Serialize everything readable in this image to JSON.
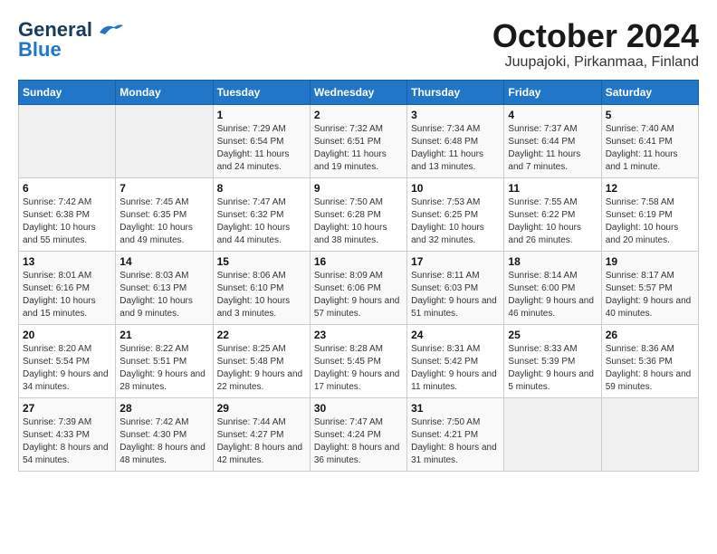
{
  "logo": {
    "line1": "General",
    "line2": "Blue"
  },
  "title": "October 2024",
  "subtitle": "Juupajoki, Pirkanmaa, Finland",
  "headers": [
    "Sunday",
    "Monday",
    "Tuesday",
    "Wednesday",
    "Thursday",
    "Friday",
    "Saturday"
  ],
  "weeks": [
    [
      {
        "day": "",
        "detail": ""
      },
      {
        "day": "",
        "detail": ""
      },
      {
        "day": "1",
        "detail": "Sunrise: 7:29 AM\nSunset: 6:54 PM\nDaylight: 11 hours and 24 minutes."
      },
      {
        "day": "2",
        "detail": "Sunrise: 7:32 AM\nSunset: 6:51 PM\nDaylight: 11 hours and 19 minutes."
      },
      {
        "day": "3",
        "detail": "Sunrise: 7:34 AM\nSunset: 6:48 PM\nDaylight: 11 hours and 13 minutes."
      },
      {
        "day": "4",
        "detail": "Sunrise: 7:37 AM\nSunset: 6:44 PM\nDaylight: 11 hours and 7 minutes."
      },
      {
        "day": "5",
        "detail": "Sunrise: 7:40 AM\nSunset: 6:41 PM\nDaylight: 11 hours and 1 minute."
      }
    ],
    [
      {
        "day": "6",
        "detail": "Sunrise: 7:42 AM\nSunset: 6:38 PM\nDaylight: 10 hours and 55 minutes."
      },
      {
        "day": "7",
        "detail": "Sunrise: 7:45 AM\nSunset: 6:35 PM\nDaylight: 10 hours and 49 minutes."
      },
      {
        "day": "8",
        "detail": "Sunrise: 7:47 AM\nSunset: 6:32 PM\nDaylight: 10 hours and 44 minutes."
      },
      {
        "day": "9",
        "detail": "Sunrise: 7:50 AM\nSunset: 6:28 PM\nDaylight: 10 hours and 38 minutes."
      },
      {
        "day": "10",
        "detail": "Sunrise: 7:53 AM\nSunset: 6:25 PM\nDaylight: 10 hours and 32 minutes."
      },
      {
        "day": "11",
        "detail": "Sunrise: 7:55 AM\nSunset: 6:22 PM\nDaylight: 10 hours and 26 minutes."
      },
      {
        "day": "12",
        "detail": "Sunrise: 7:58 AM\nSunset: 6:19 PM\nDaylight: 10 hours and 20 minutes."
      }
    ],
    [
      {
        "day": "13",
        "detail": "Sunrise: 8:01 AM\nSunset: 6:16 PM\nDaylight: 10 hours and 15 minutes."
      },
      {
        "day": "14",
        "detail": "Sunrise: 8:03 AM\nSunset: 6:13 PM\nDaylight: 10 hours and 9 minutes."
      },
      {
        "day": "15",
        "detail": "Sunrise: 8:06 AM\nSunset: 6:10 PM\nDaylight: 10 hours and 3 minutes."
      },
      {
        "day": "16",
        "detail": "Sunrise: 8:09 AM\nSunset: 6:06 PM\nDaylight: 9 hours and 57 minutes."
      },
      {
        "day": "17",
        "detail": "Sunrise: 8:11 AM\nSunset: 6:03 PM\nDaylight: 9 hours and 51 minutes."
      },
      {
        "day": "18",
        "detail": "Sunrise: 8:14 AM\nSunset: 6:00 PM\nDaylight: 9 hours and 46 minutes."
      },
      {
        "day": "19",
        "detail": "Sunrise: 8:17 AM\nSunset: 5:57 PM\nDaylight: 9 hours and 40 minutes."
      }
    ],
    [
      {
        "day": "20",
        "detail": "Sunrise: 8:20 AM\nSunset: 5:54 PM\nDaylight: 9 hours and 34 minutes."
      },
      {
        "day": "21",
        "detail": "Sunrise: 8:22 AM\nSunset: 5:51 PM\nDaylight: 9 hours and 28 minutes."
      },
      {
        "day": "22",
        "detail": "Sunrise: 8:25 AM\nSunset: 5:48 PM\nDaylight: 9 hours and 22 minutes."
      },
      {
        "day": "23",
        "detail": "Sunrise: 8:28 AM\nSunset: 5:45 PM\nDaylight: 9 hours and 17 minutes."
      },
      {
        "day": "24",
        "detail": "Sunrise: 8:31 AM\nSunset: 5:42 PM\nDaylight: 9 hours and 11 minutes."
      },
      {
        "day": "25",
        "detail": "Sunrise: 8:33 AM\nSunset: 5:39 PM\nDaylight: 9 hours and 5 minutes."
      },
      {
        "day": "26",
        "detail": "Sunrise: 8:36 AM\nSunset: 5:36 PM\nDaylight: 8 hours and 59 minutes."
      }
    ],
    [
      {
        "day": "27",
        "detail": "Sunrise: 7:39 AM\nSunset: 4:33 PM\nDaylight: 8 hours and 54 minutes."
      },
      {
        "day": "28",
        "detail": "Sunrise: 7:42 AM\nSunset: 4:30 PM\nDaylight: 8 hours and 48 minutes."
      },
      {
        "day": "29",
        "detail": "Sunrise: 7:44 AM\nSunset: 4:27 PM\nDaylight: 8 hours and 42 minutes."
      },
      {
        "day": "30",
        "detail": "Sunrise: 7:47 AM\nSunset: 4:24 PM\nDaylight: 8 hours and 36 minutes."
      },
      {
        "day": "31",
        "detail": "Sunrise: 7:50 AM\nSunset: 4:21 PM\nDaylight: 8 hours and 31 minutes."
      },
      {
        "day": "",
        "detail": ""
      },
      {
        "day": "",
        "detail": ""
      }
    ]
  ]
}
